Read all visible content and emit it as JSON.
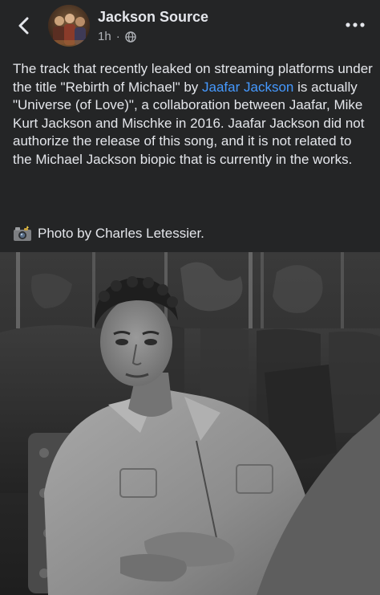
{
  "header": {
    "page_name": "Jackson Source",
    "timestamp": "1h",
    "separator": "·",
    "back_icon": "chevron-left-icon",
    "privacy_icon": "globe-icon",
    "more_icon": "more-horizontal-icon"
  },
  "post": {
    "text_before_mention": "The track that recently leaked on streaming platforms under the title \"Rebirth of Michael\" by ",
    "mention": "Jaafar Jackson",
    "text_after_mention": " is actually \"Universe (of Love)\", a collaboration between Jaafar, Mike Kurt Jackson and Mischke in 2016. Jaafar Jackson did not authorize the release of this song, and it is not related to the Michael Jackson biopic that is currently in the works.",
    "credit_icon": "camera-flash-icon",
    "credit_text": "Photo by Charles Letessier."
  },
  "colors": {
    "background": "#242526",
    "text": "#e4e6eb",
    "secondary_text": "#b0b3b8",
    "link": "#4599ff"
  }
}
